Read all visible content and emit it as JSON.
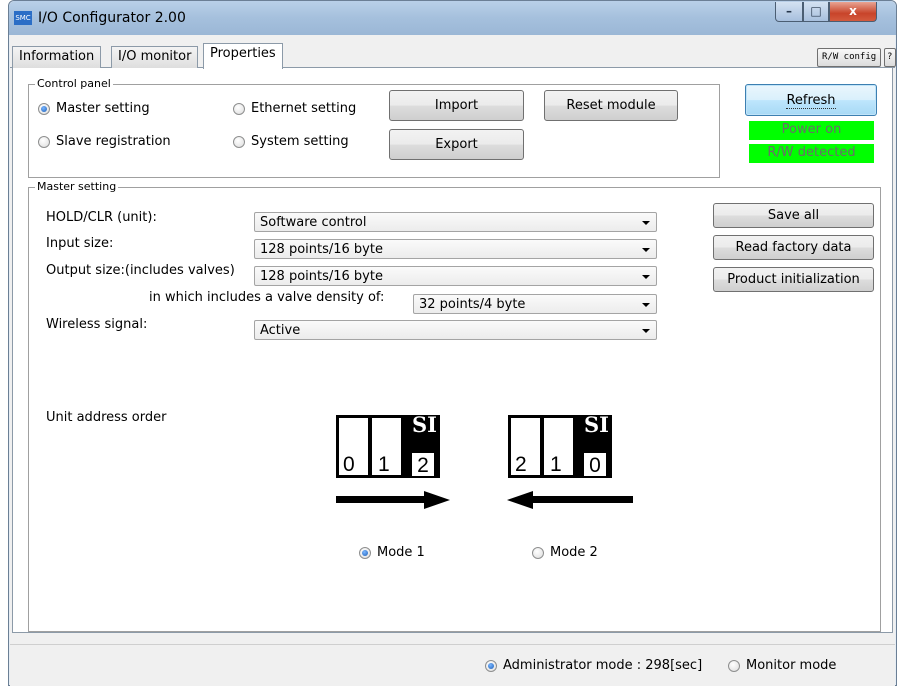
{
  "window": {
    "title": "I/O Configurator 2.00",
    "icon_label": "SMC",
    "controls": {
      "minimize": "–",
      "maximize": "□",
      "close": "x"
    }
  },
  "tabs": [
    {
      "label": "Information",
      "active": false
    },
    {
      "label": "I/O monitor",
      "active": false
    },
    {
      "label": "Properties",
      "active": true
    }
  ],
  "tab_buttons": {
    "rw_config": "R/W config",
    "help": "?"
  },
  "control_panel": {
    "title": "Control panel",
    "options": [
      {
        "label": "Master setting",
        "selected": true
      },
      {
        "label": "Ethernet setting",
        "selected": false
      },
      {
        "label": "Slave registration",
        "selected": false
      },
      {
        "label": "System setting",
        "selected": false
      }
    ],
    "import_label": "Import",
    "export_label": "Export",
    "reset_label": "Reset module"
  },
  "side": {
    "refresh_label": "Refresh",
    "status": [
      "Power on",
      "R/W detected"
    ],
    "status_color": "#00ff00",
    "save_all_label": "Save all",
    "read_factory_label": "Read factory data",
    "product_init_label": "Product initialization"
  },
  "master_setting": {
    "title": "Master setting",
    "hold_clr": {
      "label": "HOLD/CLR (unit):",
      "value": "Software control"
    },
    "input_size": {
      "label": "Input size:",
      "value": "128 points/16 byte"
    },
    "output_size": {
      "label": "Output size:(includes valves)",
      "value": "128 points/16 byte"
    },
    "valve_density": {
      "label": "in which includes a valve density of:",
      "value": "32 points/4 byte"
    },
    "wireless": {
      "label": "Wireless signal:",
      "value": "Active"
    },
    "unit_address_order": "Unit address order",
    "mode1": {
      "label": "Mode 1",
      "selected": true,
      "si": "SI",
      "numbers": [
        "0",
        "1",
        "2"
      ]
    },
    "mode2": {
      "label": "Mode 2",
      "selected": false,
      "si": "SI",
      "numbers": [
        "2",
        "1",
        "0"
      ]
    }
  },
  "footer": {
    "admin_mode": {
      "label": "Administrator mode : 298[sec]",
      "selected": true
    },
    "monitor_mode": {
      "label": "Monitor mode",
      "selected": false
    }
  }
}
